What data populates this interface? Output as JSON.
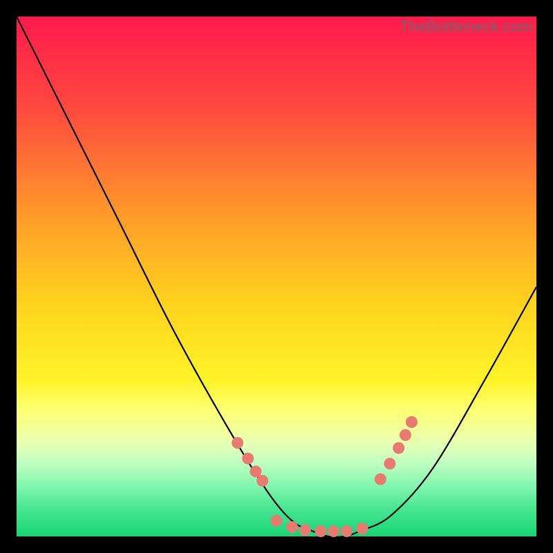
{
  "watermark": "TheBottleneck.com",
  "chart_data": {
    "type": "line",
    "title": "",
    "xlabel": "",
    "ylabel": "",
    "xlim": [
      0,
      100
    ],
    "ylim": [
      0,
      100
    ],
    "series": [
      {
        "name": "bottleneck_curve",
        "x": [
          0,
          10,
          20,
          30,
          40,
          48,
          53,
          57,
          60,
          63,
          66,
          72,
          80,
          90,
          100
        ],
        "y": [
          100,
          80,
          60,
          40,
          22,
          9,
          3,
          1,
          0,
          0,
          1,
          4,
          13,
          30,
          48
        ]
      }
    ],
    "markers": {
      "name": "highlight_dots",
      "color": "#e97a72",
      "x": [
        42.5,
        44.5,
        46.0,
        47.3,
        50.0,
        53.0,
        55.5,
        58.5,
        61.0,
        63.5,
        66.5,
        70.0,
        71.8,
        73.5,
        74.8,
        76.0
      ],
      "y": [
        18.0,
        15.0,
        12.5,
        10.7,
        3.0,
        1.8,
        1.2,
        1.0,
        1.0,
        1.0,
        1.5,
        11.0,
        14.0,
        17.0,
        19.5,
        22.0
      ]
    },
    "gradient_stops": [
      {
        "offset": 0.0,
        "color": "#ff1a4d"
      },
      {
        "offset": 0.18,
        "color": "#ff4a3e"
      },
      {
        "offset": 0.38,
        "color": "#ff9a2a"
      },
      {
        "offset": 0.55,
        "color": "#ffd21e"
      },
      {
        "offset": 0.7,
        "color": "#fff428"
      },
      {
        "offset": 0.75,
        "color": "#fdff6a"
      },
      {
        "offset": 0.8,
        "color": "#f3ff9e"
      },
      {
        "offset": 0.83,
        "color": "#deffb9"
      },
      {
        "offset": 0.86,
        "color": "#beffc0"
      },
      {
        "offset": 0.9,
        "color": "#86f7b0"
      },
      {
        "offset": 0.94,
        "color": "#4fe896"
      },
      {
        "offset": 1.0,
        "color": "#16d574"
      }
    ]
  }
}
